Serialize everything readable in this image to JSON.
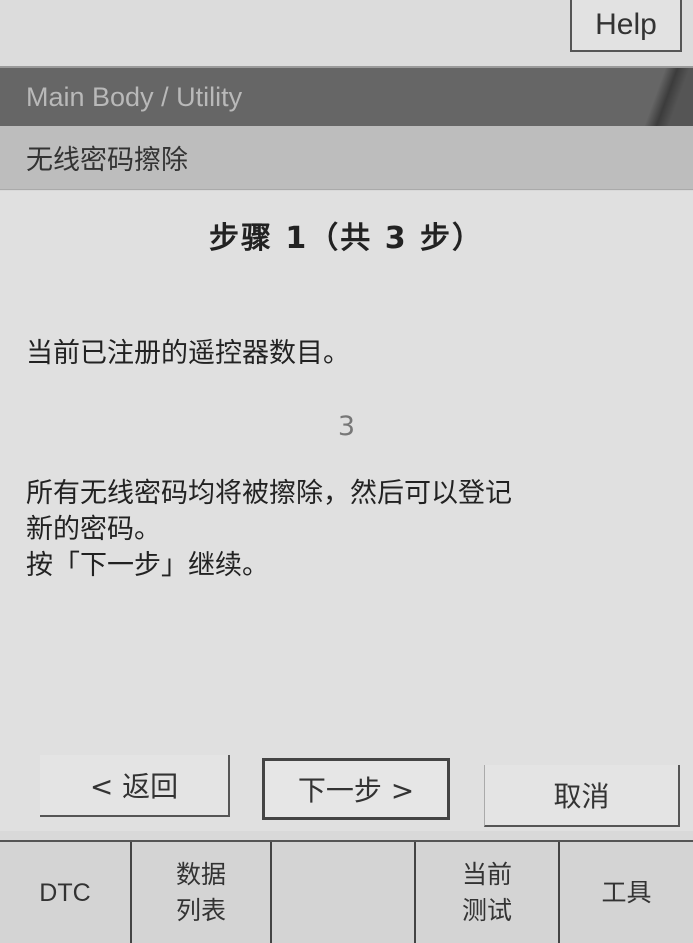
{
  "header": {
    "help_label": "Help"
  },
  "path": {
    "text": "Main Body / Utility"
  },
  "screen_title": "无线密码擦除",
  "content": {
    "step_heading": "步骤 1（共 3 步）",
    "registered_label": "当前已注册的遥控器数目。",
    "registered_count": "3",
    "instructions_line1": "所有无线密码均将被擦除，然后可以登记",
    "instructions_line2": "新的密码。",
    "instructions_line3": "按「下一步」继续。"
  },
  "buttons": {
    "back": "< 返回",
    "next": "下一步 >",
    "cancel": "取消"
  },
  "tabs": {
    "dtc": "DTC",
    "data_list_1": "数据",
    "data_list_2": "列表",
    "empty": "",
    "current_test_1": "当前",
    "current_test_2": "测试",
    "tools": "工具"
  }
}
